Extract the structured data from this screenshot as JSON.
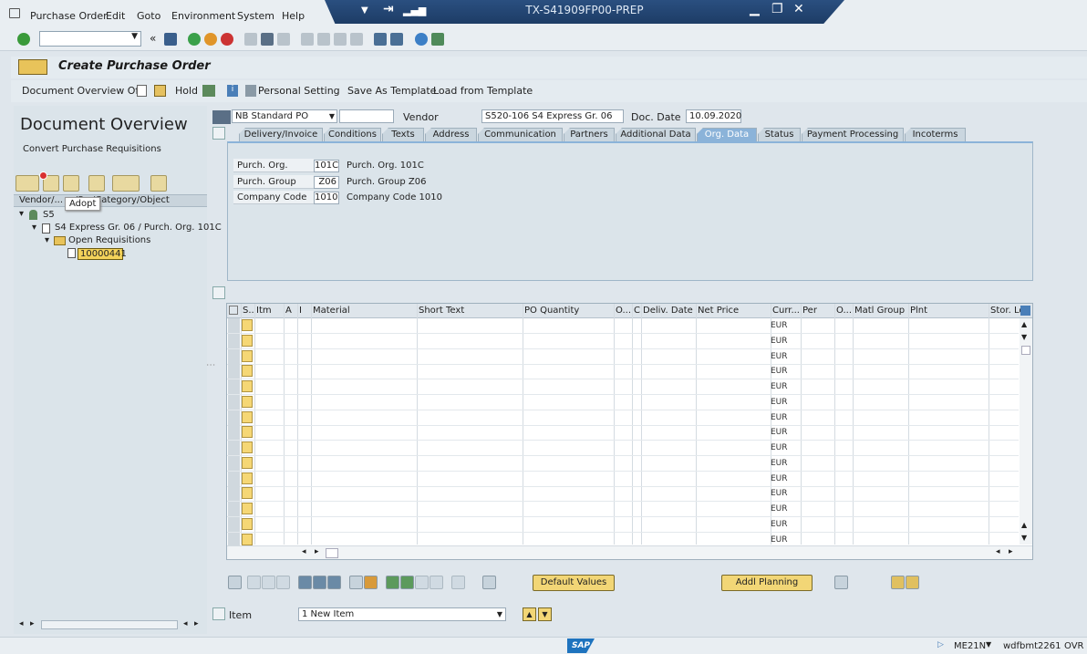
{
  "window": {
    "title": "TX-S41909FP00-PREP"
  },
  "menu": [
    "Purchase Order",
    "Edit",
    "Goto",
    "Environment",
    "System",
    "Help"
  ],
  "screen": {
    "title": "Create Purchase Order"
  },
  "app_toolbar": {
    "doc_overview_off": "Document Overview Off",
    "hold": "Hold",
    "personal_setting": "Personal Setting",
    "save_as_template": "Save As Template",
    "load_from_template": "Load from Template"
  },
  "left_panel": {
    "title": "Document Overview",
    "subtitle": "Convert Purchase Requisitions",
    "tooltip": "Adopt",
    "tree_header": "Vendor/... .../Src/Category/Object",
    "tree": {
      "root": "S5",
      "group": "S4 Express Gr. 06 / Purch. Org. 101C",
      "folder": "Open Requisitions",
      "item": "10000441"
    }
  },
  "header": {
    "order_type": "NB Standard PO",
    "order_number": "",
    "vendor_label": "Vendor",
    "vendor_value": "S520-106 S4 Express Gr. 06",
    "doc_date_label": "Doc. Date",
    "doc_date_value": "10.09.2020"
  },
  "tabs": [
    "Delivery/Invoice",
    "Conditions",
    "Texts",
    "Address",
    "Communication",
    "Partners",
    "Additional Data",
    "Org. Data",
    "Status",
    "Payment Processing",
    "Incoterms"
  ],
  "active_tab": "Org. Data",
  "org_data": [
    {
      "label": "Purch. Org.",
      "code": "101C",
      "desc": "Purch. Org. 101C"
    },
    {
      "label": "Purch. Group",
      "code": "Z06",
      "desc": "Purch. Group Z06"
    },
    {
      "label": "Company Code",
      "code": "1010",
      "desc": "Company Code 1010"
    }
  ],
  "grid": {
    "columns": [
      "S..",
      "Itm",
      "A",
      "I",
      "Material",
      "Short Text",
      "PO Quantity",
      "O...",
      "C",
      "Deliv. Date",
      "Net Price",
      "Curr...",
      "Per",
      "O...",
      "Matl Group",
      "Plnt",
      "Stor. Lo"
    ],
    "currency": "EUR",
    "row_count": 15
  },
  "bottom": {
    "default_values": "Default Values",
    "addl_planning": "Addl Planning",
    "item_label": "Item",
    "item_value": "1 New Item"
  },
  "status": {
    "transaction": "ME21N",
    "server": "wdfbmt2261",
    "mode": "OVR",
    "logo": "SAP"
  }
}
